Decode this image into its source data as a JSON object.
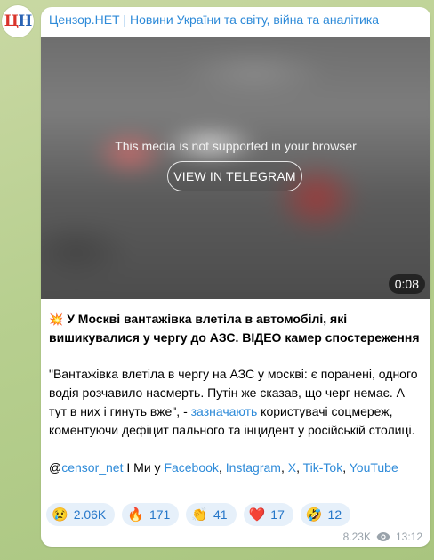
{
  "channel": {
    "avatar_text_1": "Ц",
    "avatar_text_2": "Н",
    "name": "Цензор.НЕТ | Новини України та світу, війна та аналітика"
  },
  "media": {
    "message": "This media is not supported in your browser",
    "view_button": "VIEW IN TELEGRAM",
    "duration": "0:08"
  },
  "post": {
    "headline_emoji": "💥",
    "headline": "У Москві вантажівка влетіла в автомобілі, які вишикувалися у чергу до АЗС. ВІДЕО камер спостереження",
    "quote_text": "\"Вантажівка влетіла в чергу на АЗС у москві: є поранені, одного водія розчавило насмерть. Путін же сказав, що черг немає. А тут в них і гинуть вже\", - ",
    "quote_link": "зазначають",
    "quote_tail": " користувачі соцмереж, коментуючи дефіцит пального та інцидент у російській столиці.",
    "at_sign": "@",
    "handle_link": "censor_net",
    "mid_text": " І Ми у ",
    "facebook": "Facebook",
    "instagram": "Instagram",
    "x": "X",
    "tiktok": "Tik-Tok",
    "youtube": "YouTube",
    "comma": ", "
  },
  "reactions": [
    {
      "emoji": "😢",
      "count": "2.06K"
    },
    {
      "emoji": "🔥",
      "count": "171"
    },
    {
      "emoji": "👏",
      "count": "41"
    },
    {
      "emoji": "❤️",
      "count": "17"
    },
    {
      "emoji": "🤣",
      "count": "12"
    }
  ],
  "meta": {
    "views": "8.23K",
    "time": "13:12"
  },
  "colors": {
    "link": "#2d8ad8",
    "reaction_bg": "#e6f0fa",
    "reaction_text": "#2677c9"
  }
}
